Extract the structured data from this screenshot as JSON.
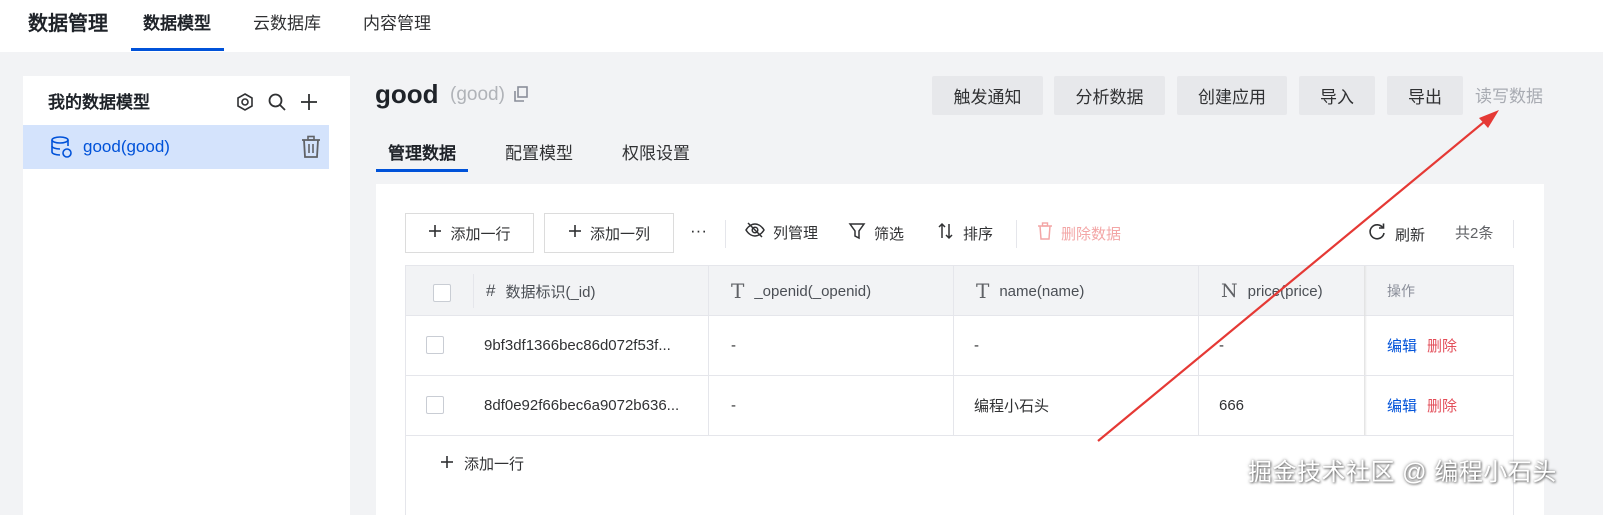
{
  "topnav": {
    "brand": "数据管理",
    "tabs": [
      {
        "label": "数据模型",
        "active": true
      },
      {
        "label": "云数据库",
        "active": false
      },
      {
        "label": "内容管理",
        "active": false
      }
    ]
  },
  "sidebar": {
    "title": "我的数据模型",
    "icons": [
      "settings-icon",
      "search-icon",
      "plus-icon"
    ],
    "models": [
      {
        "label": "good(good)",
        "selected": true
      }
    ]
  },
  "model": {
    "name": "good",
    "id": "(good)"
  },
  "header_buttons": {
    "trigger": "触发通知",
    "analyze": "分析数据",
    "create_app": "创建应用",
    "import": "导入",
    "export": "导出",
    "read_write": "读写数据"
  },
  "subtabs": [
    {
      "label": "管理数据",
      "active": true
    },
    {
      "label": "配置模型",
      "active": false
    },
    {
      "label": "权限设置",
      "active": false
    }
  ],
  "toolbar": {
    "add_row": "添加一行",
    "add_col": "添加一列",
    "more": "···",
    "col_manage": "列管理",
    "filter": "筛选",
    "sort": "排序",
    "delete_data": "删除数据",
    "refresh": "刷新",
    "count": "共2条"
  },
  "table": {
    "columns": [
      {
        "type_icon": "#",
        "label": "数据标识(_id)"
      },
      {
        "type_icon": "T",
        "label": "_openid(_openid)"
      },
      {
        "type_icon": "T",
        "label": "name(name)"
      },
      {
        "type_icon": "N",
        "label": "price(price)"
      },
      {
        "type_icon": "",
        "label": "操作"
      }
    ],
    "rows": [
      {
        "id": "9bf3df1366bec86d072f53f...",
        "openid": "-",
        "name": "-",
        "price": "-"
      },
      {
        "id": "8df0e92f66bec6a9072b636...",
        "openid": "-",
        "name": "编程小石头",
        "price": "666"
      }
    ],
    "action_edit": "编辑",
    "action_delete": "删除",
    "add_row": "添加一行"
  },
  "watermark": "掘金技术社区 @ 编程小石头",
  "colors": {
    "accent": "#0052d9",
    "danger": "#e34d59",
    "annotation_arrow": "#e53935"
  }
}
